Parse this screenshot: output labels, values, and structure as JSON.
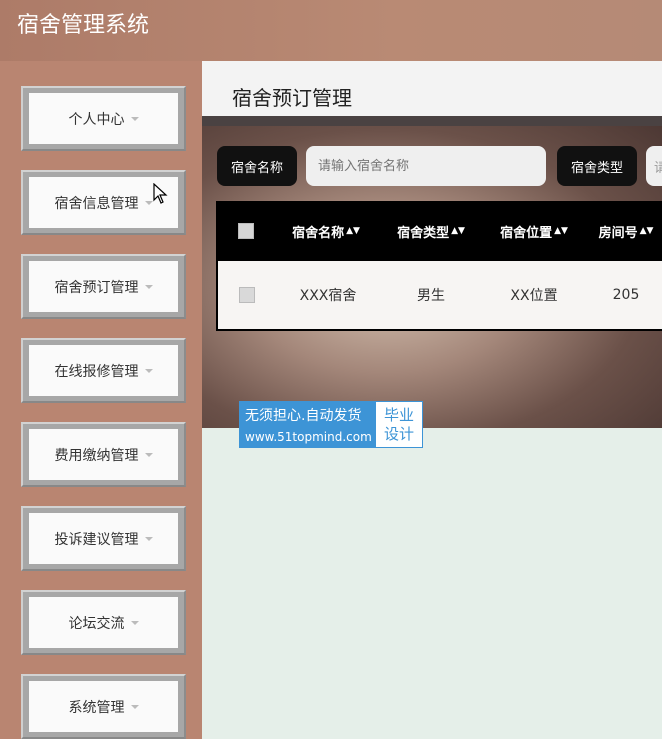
{
  "app": {
    "title": "宿舍管理系统"
  },
  "sidebar": {
    "items": [
      {
        "label": "个人中心"
      },
      {
        "label": "宿舍信息管理"
      },
      {
        "label": "宿舍预订管理"
      },
      {
        "label": "在线报修管理"
      },
      {
        "label": "费用缴纳管理"
      },
      {
        "label": "投诉建议管理"
      },
      {
        "label": "论坛交流"
      },
      {
        "label": "系统管理"
      }
    ]
  },
  "page": {
    "title": "宿舍预订管理"
  },
  "search": {
    "name_label": "宿舍名称",
    "name_placeholder": "请输入宿舍名称",
    "type_label": "宿舍类型",
    "type_placeholder_partial": "请"
  },
  "table": {
    "columns": [
      "宿舍名称",
      "宿舍类型",
      "宿舍位置",
      "房间号"
    ],
    "rows": [
      {
        "name": "XXX宿舍",
        "type": "男生",
        "location": "XX位置",
        "room": "205"
      }
    ]
  },
  "watermark": {
    "line1": "无须担心.自动发货",
    "line2": "www.51topmind.com",
    "right_top": "毕业",
    "right_bottom": "设计"
  },
  "colors": {
    "topbar": "#b4826e",
    "sidebar": "#b98571",
    "content_bg": "#e5efe9",
    "accent": "#3d94d6"
  }
}
